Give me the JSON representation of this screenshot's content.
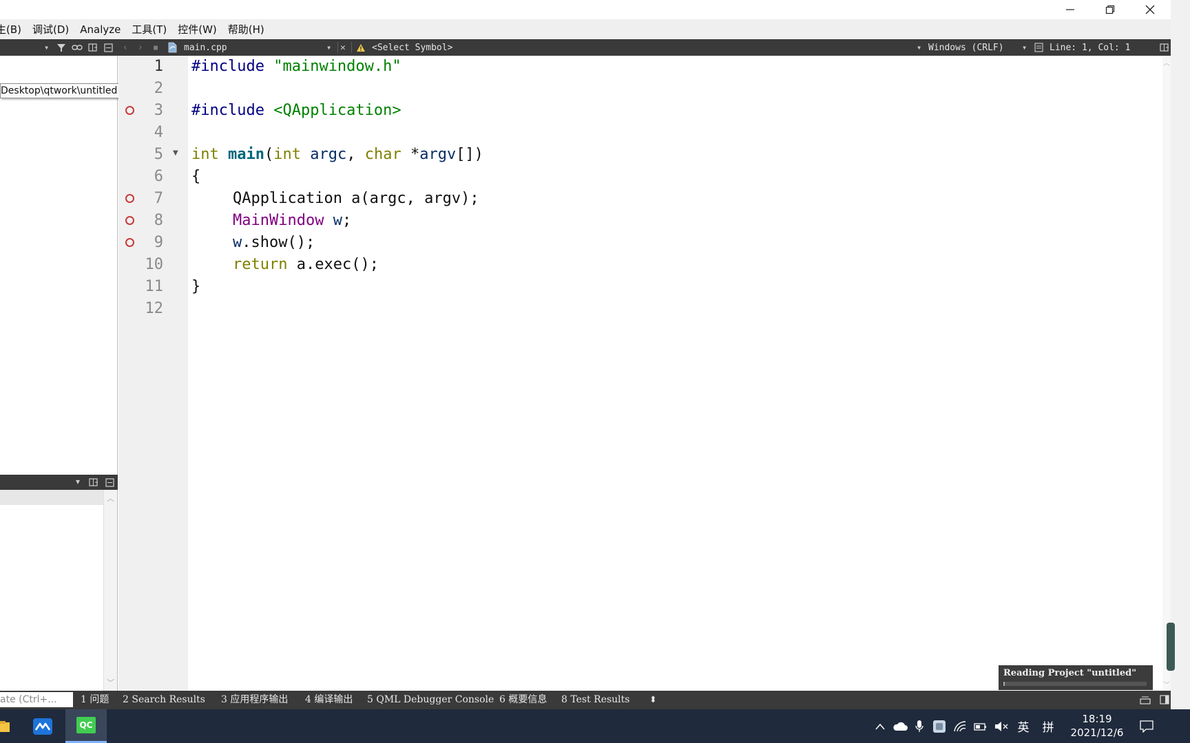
{
  "titlebar": {
    "minimize_glyph": "─",
    "restore_glyph": "❐",
    "close_glyph": "✕"
  },
  "menu": {
    "items": [
      "生(B)",
      "调试(D)",
      "Analyze",
      "工具(T)",
      "控件(W)",
      "帮助(H)"
    ]
  },
  "toolbar": {
    "file_name": "main.cpp",
    "symbol_selector": "<Select Symbol>",
    "line_ending": "Windows (CRLF)",
    "cursor_position": "Line: 1, Col: 1"
  },
  "sidebar": {
    "path_tooltip": "Desktop\\qtwork\\untitled"
  },
  "editor": {
    "lines": [
      {
        "num": "1",
        "current": true,
        "breakpoint": false,
        "fold": false
      },
      {
        "num": "2",
        "current": false,
        "breakpoint": false,
        "fold": false
      },
      {
        "num": "3",
        "current": false,
        "breakpoint": true,
        "fold": false
      },
      {
        "num": "4",
        "current": false,
        "breakpoint": false,
        "fold": false
      },
      {
        "num": "5",
        "current": false,
        "breakpoint": false,
        "fold": true
      },
      {
        "num": "6",
        "current": false,
        "breakpoint": false,
        "fold": false
      },
      {
        "num": "7",
        "current": false,
        "breakpoint": true,
        "fold": false
      },
      {
        "num": "8",
        "current": false,
        "breakpoint": true,
        "fold": false
      },
      {
        "num": "9",
        "current": false,
        "breakpoint": true,
        "fold": false
      },
      {
        "num": "10",
        "current": false,
        "breakpoint": false,
        "fold": false
      },
      {
        "num": "11",
        "current": false,
        "breakpoint": false,
        "fold": false
      },
      {
        "num": "12",
        "current": false,
        "breakpoint": false,
        "fold": false
      }
    ],
    "code": {
      "l1_directive": "#include",
      "l1_header": "\"mainwindow.h\"",
      "l3_directive": "#include",
      "l3_header": "<QApplication>",
      "l5_type1": "int",
      "l5_func": "main",
      "l5_paren_open": "(",
      "l5_type2": "int",
      "l5_param1": "argc",
      "l5_comma": ", ",
      "l5_type3": "char",
      "l5_star": " *",
      "l5_param2": "argv",
      "l5_tail": "[])",
      "l6_brace": "{",
      "l7_text": "QApplication a(argc, argv);",
      "l8_class": "MainWindow",
      "l8_var": "w",
      "l8_semi": ";",
      "l9_var": "w",
      "l9_rest": ".show();",
      "l10_kw": "return",
      "l10_rest": " a.exec();",
      "l11_brace": "}"
    }
  },
  "progress": {
    "label": "Reading Project \"untitled\"",
    "fraction": 0.01
  },
  "output_bar": {
    "locator_placeholder": "ate (Ctrl+...",
    "tabs": [
      "1 问题",
      "2 Search Results",
      "3 应用程序输出",
      "4 编译输出",
      "5 QML Debugger Console",
      "6 概要信息",
      "8 Test Results"
    ],
    "more_glyph": "⬍"
  },
  "taskbar": {
    "qt_label": "QC",
    "time": "18:19",
    "date": "2021/12/6",
    "ime_lang": "英",
    "ime_mode": "拼"
  },
  "colors": {
    "toolbar_bg": "#3a3a3a",
    "gutter_bg": "#f0f0f0",
    "breakpoint": "#c93a3a",
    "taskbar_bg": "#1f2a3c",
    "string_green": "#008000",
    "keyword_olive": "#808000",
    "class_purple": "#800080",
    "function_teal": "#00677c"
  }
}
